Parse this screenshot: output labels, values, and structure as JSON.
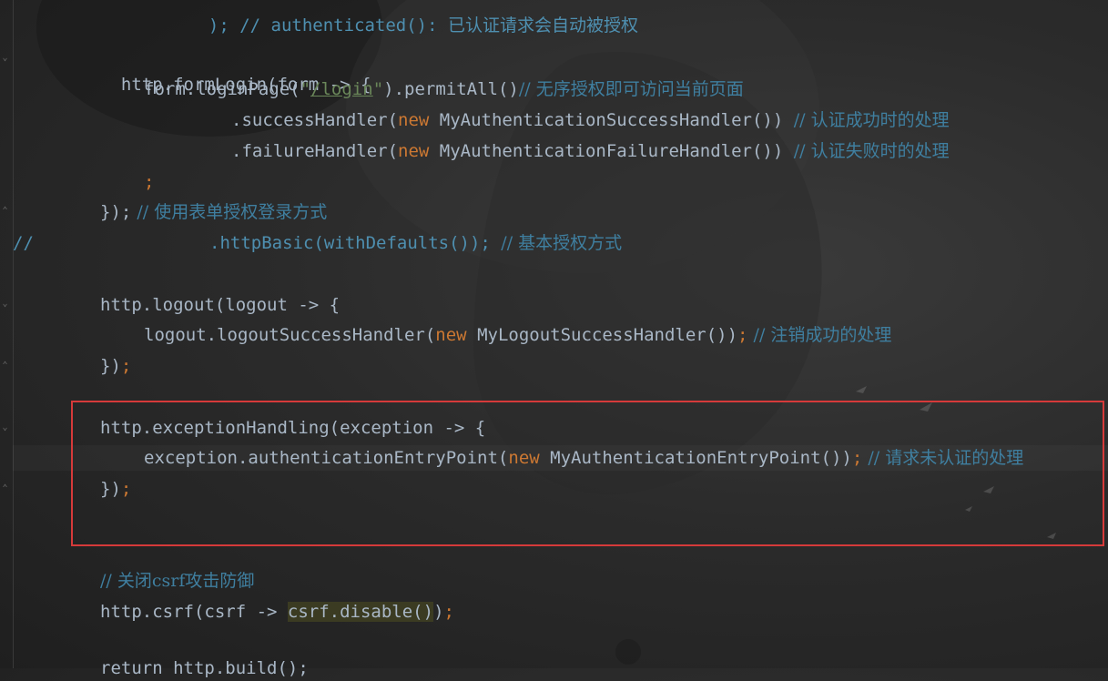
{
  "editor": {
    "line_top": {
      "text": "); // authenticated(): 已认证请求会自动被授权"
    },
    "form_login": {
      "open": "http.formLogin(form -> {",
      "login_page_prefix": "form.loginPage(",
      "login_page_quote1": "\"",
      "login_page_url": "/login",
      "login_page_quote2": "\"",
      "login_page_suffix": ").permitAll()",
      "login_page_comment": "// 无序授权即可访问当前页面",
      "success_prefix": ".successHandler(",
      "success_new": "new",
      "success_class": " MyAuthenticationSuccessHandler()) ",
      "success_comment": "// 认证成功时的处理",
      "failure_prefix": ".failureHandler(",
      "failure_new": "new",
      "failure_class": " MyAuthenticationFailureHandler()) ",
      "failure_comment": "// 认证失败时的处理",
      "semicolon": ";",
      "close": "});",
      "close_semi": ";",
      "close_comment": " // 使用表单授权登录方式"
    },
    "http_basic": {
      "comment_marker": "//",
      "code": ".httpBasic(withDefaults()); ",
      "comment": "// 基本授权方式"
    },
    "logout": {
      "open": "http.logout(logout -> {",
      "handler_prefix": "logout.logoutSuccessHandler(",
      "handler_new": "new",
      "handler_class": " MyLogoutSuccessHandler())",
      "handler_semi": ";",
      "handler_comment": " // 注销成功的处理",
      "close": "})",
      "close_semi": ";"
    },
    "exception": {
      "open": "http.exceptionHandling(exception -> {",
      "entry_prefix": "exception.authenticationEntryPoint(",
      "entry_new": "new",
      "entry_class": " MyAuthenticationEntryPoint())",
      "entry_semi": ";",
      "entry_comment": " // 请求未认证的处理",
      "close": "})",
      "close_semi": ";"
    },
    "csrf": {
      "comment": "// 关闭csrf攻击防御",
      "code_prefix": "http.csrf(csrf -> ",
      "code_highlight": "csrf.disable()",
      "code_suffix": ")",
      "code_semi": ";"
    },
    "line_bottom": {
      "text": "return http.build();"
    }
  },
  "colors": {
    "code": "#a9b7c6",
    "keyword": "#cc7832",
    "comment": "#4e8fb0",
    "string": "#6a8759",
    "highlight_box": "#d63a3a"
  }
}
